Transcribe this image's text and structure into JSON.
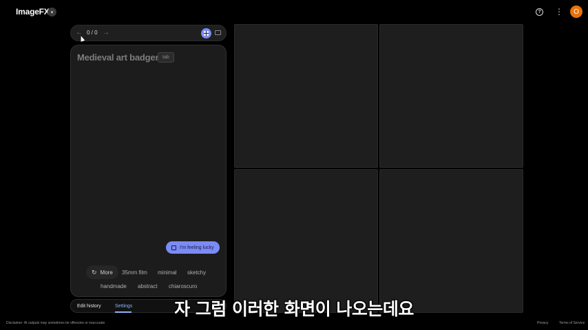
{
  "app": {
    "title": "ImageFX",
    "avatar_initial": "O",
    "accent": "#7b8bf5",
    "avatar_color": "#e8710a"
  },
  "navigator": {
    "count": "0 / 0"
  },
  "prompt": {
    "text": "Medieval art badger",
    "tab_hint": "tab"
  },
  "lucky_button": {
    "label": "I'm feeling lucky"
  },
  "chips": {
    "more": "More",
    "items": [
      "35mm film",
      "minimal",
      "sketchy",
      "handmade",
      "abstract",
      "chiaroscuro"
    ]
  },
  "tabs": {
    "edit_history": "Edit history",
    "settings": "Settings"
  },
  "footer": {
    "disclaimer": "Disclaimer: AI outputs may sometimes be offensive or inaccurate",
    "privacy": "Privacy",
    "terms": "Terms of Service"
  },
  "subtitle": "자 그럼 이러한 화면이 나오는데요"
}
